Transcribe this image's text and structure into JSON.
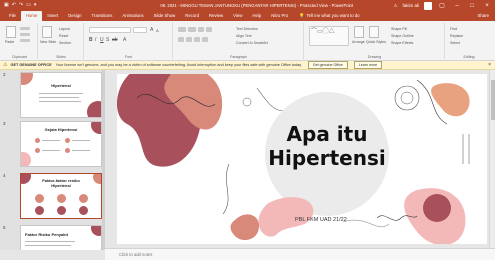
{
  "window": {
    "title": "08. 2021 - MINGGU TEMAN JANTUNGKU (PENGANTAR HIPERTENSI) - Protected View - PowerPoint",
    "user": "fakim ali",
    "quick_access": [
      "save-icon",
      "undo-icon",
      "redo-icon",
      "present-icon"
    ]
  },
  "tabs": [
    "File",
    "Home",
    "Insert",
    "Design",
    "Transitions",
    "Animations",
    "Slide Show",
    "Record",
    "Review",
    "View",
    "Help",
    "Nitro Pro"
  ],
  "active_tab": "Home",
  "tell_me": "Tell me what you want to do",
  "share": "Share",
  "ribbon": {
    "groups": [
      "Clipboard",
      "Slides",
      "Font",
      "Paragraph",
      "Drawing",
      "Editing"
    ],
    "clipboard": {
      "paste": "Paste"
    },
    "slides": {
      "new_slide": "New Slide",
      "layout": "Layout",
      "reset": "Reset",
      "section": "Section"
    },
    "paragraph": {
      "text_direction": "Text Direction",
      "align_text": "Align Text",
      "smartart": "Convert to SmartArt"
    },
    "drawing": {
      "arrange": "Arrange",
      "quick_styles": "Quick Styles",
      "shape_fill": "Shape Fill",
      "shape_outline": "Shape Outline",
      "shape_effects": "Shape Effects"
    },
    "editing": {
      "find": "Find",
      "replace": "Replace",
      "select": "Select"
    }
  },
  "message_bar": {
    "title": "GET GENUINE OFFICE",
    "text": "Your license isn't genuine, and you may be a victim of software counterfeiting. Avoid interruption and keep your files safe with genuine Office today.",
    "button_primary": "Get genuine Office",
    "button_secondary": "Learn more"
  },
  "thumbnails": [
    {
      "number": "2",
      "title": "Hipertensi"
    },
    {
      "number": "3",
      "title": "Gejala Hipertensi"
    },
    {
      "number": "4",
      "title": "Faktor-faktor resiko Hipertensi"
    },
    {
      "number": "5",
      "title": "Faktor Risiko Penyakit"
    }
  ],
  "slide": {
    "title_line1": "Apa itu",
    "title_line2": "Hipertensi",
    "footer": "PBL FKM UAD 21/22"
  },
  "notes_placeholder": "Click to add notes",
  "colors": {
    "accent": "#b7472a",
    "blob_dark": "#a8505c",
    "blob_salmon": "#d9897a",
    "blob_pink": "#f3b9b9",
    "blob_orange": "#e9a27f",
    "blob_gray": "#ebebeb"
  }
}
